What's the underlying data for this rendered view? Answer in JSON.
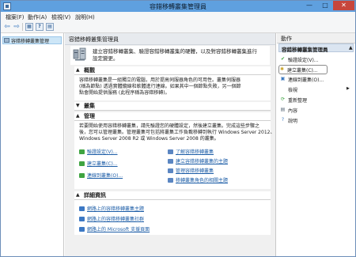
{
  "window": {
    "title": "容錯移轉叢集管理員",
    "minimize": "—",
    "maximize": "□",
    "close": "✕"
  },
  "menu": {
    "items": [
      "檔案(F)",
      "動作(A)",
      "檢視(V)",
      "說明(H)"
    ]
  },
  "toolbar": {
    "back_icon": "back-arrow-icon",
    "forward_icon": "forward-arrow-icon",
    "back_glyph": "⇦",
    "forward_glyph": "⇨",
    "btn1": "▦",
    "btn2": "?",
    "btn3": "▤"
  },
  "tree": {
    "root_label": "容錯移轉叢集管理"
  },
  "center": {
    "header": "容錯移轉叢集管理員",
    "banner_text_1": "建立容錯移轉叢集、驗證容錯移轉叢集的硬體，以及對容錯移轉叢集進行",
    "banner_text_2": "設定變更。",
    "overview": {
      "title": "概觀",
      "lines": [
        "容錯移轉叢集是一組獨立的電腦，用於提高伺服器角色的可用性。叢集伺服器",
        "(稱為節點) 透過實體纜線和軟體進行連線。如果其中一個節點失敗，另一個節",
        "點會開始提供服務 (此程序稱為容錯移轉)。"
      ]
    },
    "clusters": {
      "title": "叢集"
    },
    "management": {
      "title": "管理",
      "lines": [
        "若要開始使用容錯移轉叢集，請先驗證您的硬體設定，然後建立叢集。完成這些步驟之",
        "後，您可以管理叢集。管理叢集可包括將叢集工作負載移轉到執行 Windows Server 2012、",
        "Windows Server 2008 R2 或 Windows Server 2008 的叢集。"
      ],
      "links_left": [
        "驗證設定(V)...",
        "建立叢集(C)...",
        "連線到叢集(O)..."
      ],
      "links_right": [
        "了解容錯移轉叢集",
        "建立容錯移轉叢集的主題",
        "管理容錯移轉叢集",
        "移轉叢集角色的相關主題"
      ]
    },
    "more_info": {
      "title": "詳細資訊",
      "links": [
        "網路上的容錯移轉叢集主題",
        "網路上的容錯移轉叢集社群",
        "網路上的 Microsoft 支援頁面"
      ]
    }
  },
  "actions": {
    "header": "動作",
    "group_title": "容錯移轉叢集管理員",
    "items": [
      {
        "label": "驗證設定(V)...",
        "icon": "validate-icon"
      },
      {
        "label": "建立叢集(C)...",
        "icon": "create-cluster-icon"
      },
      {
        "label": "連線到叢集(O)...",
        "icon": "connect-icon"
      },
      {
        "label": "檢視",
        "icon": "view-icon",
        "submenu": true
      },
      {
        "label": "重新整理",
        "icon": "refresh-icon"
      },
      {
        "label": "內容",
        "icon": "properties-icon"
      },
      {
        "label": "說明",
        "icon": "help-icon"
      }
    ]
  },
  "colors": {
    "title_bar": "#5fa0df",
    "close_button": "#c7463c",
    "link": "#1f5fa8",
    "selected_tree": "#cde6f7",
    "actions_group": "#dbe5f1"
  }
}
